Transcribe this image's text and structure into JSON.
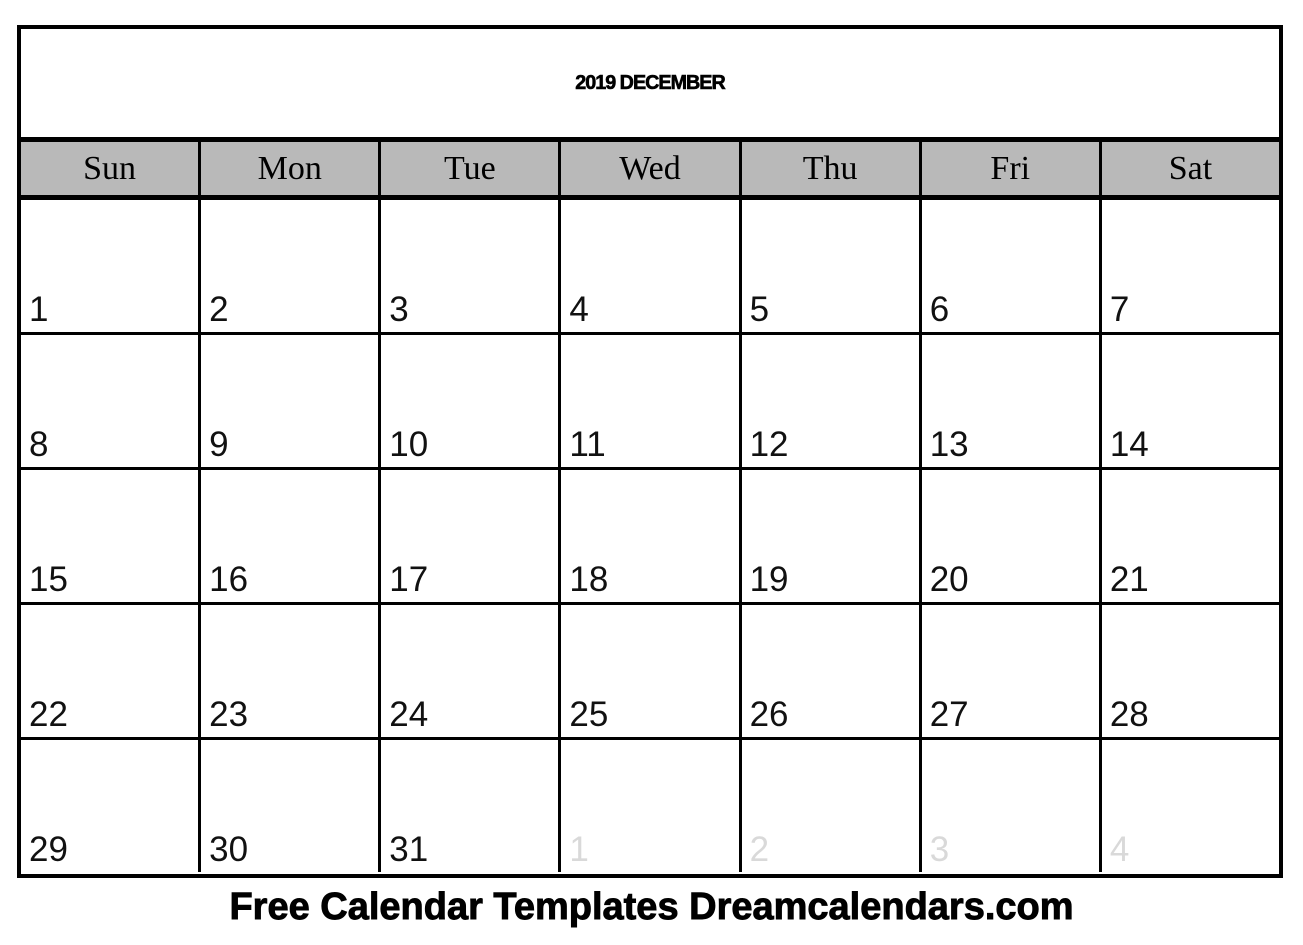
{
  "calendar": {
    "title": "2019 DECEMBER",
    "year": "2019",
    "month_name": "DECEMBER",
    "weekday_headers": [
      "Sun",
      "Mon",
      "Tue",
      "Wed",
      "Thu",
      "Fri",
      "Sat"
    ],
    "colors": {
      "header_background": "#b9b9b9",
      "border": "#000000",
      "cell_background": "#ffffff",
      "day_number": "#111111",
      "other_month_day_number": "#d9d9d9",
      "page_background": "#ffffff"
    },
    "weeks": [
      [
        {
          "day": "1",
          "other_month": false
        },
        {
          "day": "2",
          "other_month": false
        },
        {
          "day": "3",
          "other_month": false
        },
        {
          "day": "4",
          "other_month": false
        },
        {
          "day": "5",
          "other_month": false
        },
        {
          "day": "6",
          "other_month": false
        },
        {
          "day": "7",
          "other_month": false
        }
      ],
      [
        {
          "day": "8",
          "other_month": false
        },
        {
          "day": "9",
          "other_month": false
        },
        {
          "day": "10",
          "other_month": false
        },
        {
          "day": "11",
          "other_month": false
        },
        {
          "day": "12",
          "other_month": false
        },
        {
          "day": "13",
          "other_month": false
        },
        {
          "day": "14",
          "other_month": false
        }
      ],
      [
        {
          "day": "15",
          "other_month": false
        },
        {
          "day": "16",
          "other_month": false
        },
        {
          "day": "17",
          "other_month": false
        },
        {
          "day": "18",
          "other_month": false
        },
        {
          "day": "19",
          "other_month": false
        },
        {
          "day": "20",
          "other_month": false
        },
        {
          "day": "21",
          "other_month": false
        }
      ],
      [
        {
          "day": "22",
          "other_month": false
        },
        {
          "day": "23",
          "other_month": false
        },
        {
          "day": "24",
          "other_month": false
        },
        {
          "day": "25",
          "other_month": false
        },
        {
          "day": "26",
          "other_month": false
        },
        {
          "day": "27",
          "other_month": false
        },
        {
          "day": "28",
          "other_month": false
        }
      ],
      [
        {
          "day": "29",
          "other_month": false
        },
        {
          "day": "30",
          "other_month": false
        },
        {
          "day": "31",
          "other_month": false
        },
        {
          "day": "1",
          "other_month": true
        },
        {
          "day": "2",
          "other_month": true
        },
        {
          "day": "3",
          "other_month": true
        },
        {
          "day": "4",
          "other_month": true
        }
      ]
    ]
  },
  "footer": {
    "text": "Free Calendar Templates Dreamcalendars.com"
  }
}
